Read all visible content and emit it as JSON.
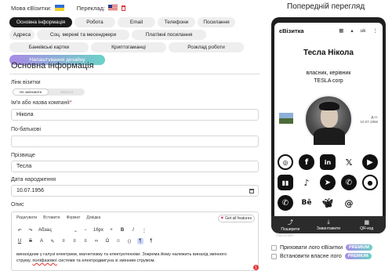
{
  "topbar": {
    "language_label": "Мова єВізитки:",
    "translation_label": "Переклад:"
  },
  "tabs": [
    "Основна інформація",
    "Робота",
    "Email",
    "Телефони",
    "Посилання",
    "Адреса",
    "Соц. мережі та месенджери",
    "Платіжні посилання",
    "Банківські картки",
    "Криптогаманці",
    "Розклад роботи",
    "Налаштування дизайну"
  ],
  "colors": {
    "active_tab": "#1b1b1b",
    "design_tab_gradient": [
      "#a98ae6",
      "#6bd2c6"
    ]
  },
  "form": {
    "section_title": "Основна інформація",
    "link_label": "Лінк візитки",
    "link_toggle": {
      "selected": "Не змінювати",
      "other": "Змінити"
    },
    "company_label": "Ім'я або назва компанії",
    "company_value": "Нікола",
    "patronymic_label": "По-батькові",
    "patronymic_value": "",
    "surname_label": "Прізвище",
    "surname_value": "Тесла",
    "dob_label": "Дата народження",
    "dob_value": "10.07.1956",
    "desc_label": "Опис"
  },
  "editor": {
    "menu": [
      "Редагувати",
      "Вставити",
      "Формат",
      "Довідка"
    ],
    "get_all_features": "Get all features",
    "block_format": "Абзац",
    "font_size": "16px",
    "text_1": "винахідник у галузі електрики, магнетизму та електротехніки. Зокрема йому належить винахід змінного",
    "text_2a": "струму, ",
    "text_2_misspelled": "поліфазової",
    "text_2b": " системи та електродвигуна зі змінним струмом.",
    "error_badge": "1"
  },
  "preview": {
    "title": "Попередній перегляд",
    "logo": "єВізитка",
    "lang": "uk",
    "name": "Тесла Нікола",
    "position_1": "власник, керівник",
    "position_2": "TESLA corp",
    "dob_label": "Д.Н.",
    "dob": "10.07.1956",
    "socials": [
      "instagram-icon",
      "facebook-icon",
      "linkedin-icon",
      "x-icon",
      "youtube-icon",
      "twitch-icon",
      "tiktok-icon",
      "telegram-icon",
      "viber-icon",
      "signal-icon",
      "whatsapp-icon",
      "behance-icon",
      "bluesky-icon",
      "threads-icon"
    ],
    "bottom": [
      "Поширити",
      "Завантажити",
      "QR-код"
    ]
  },
  "options": {
    "faint_text": "Логотип",
    "hide_logo": "Приховати лого єВізитки",
    "own_logo": "Встановити власне лого",
    "premium": "PREMIUM"
  }
}
